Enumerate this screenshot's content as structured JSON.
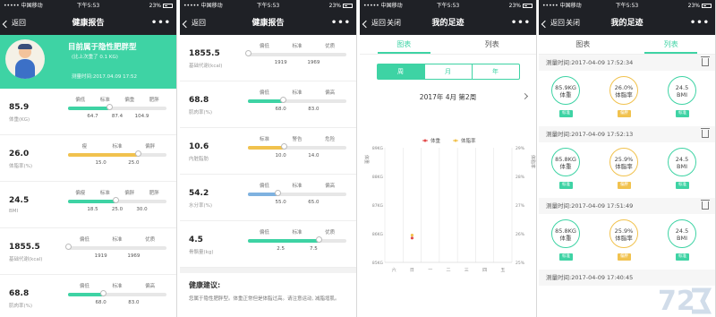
{
  "status": {
    "carrier": "••••• 中国移动",
    "time": "下午5:53",
    "battery": "23%"
  },
  "screen1": {
    "nav": {
      "back": "返回",
      "title": "健康报告",
      "more": "•••"
    },
    "hero": {
      "headline": "目前属于隐性肥胖型",
      "sub": "(比上次重了 0.1 KG)",
      "time": "测量时间:2017.04.09 17:52"
    },
    "metrics": [
      {
        "value": "85.9",
        "name": "体重(KG)",
        "cats": [
          "偏低",
          "标准",
          "偏重",
          "肥胖"
        ],
        "ticks": [
          "64.7",
          "87.4",
          "104.9"
        ],
        "fill_color": "#3ed3a4",
        "position": 0.42
      },
      {
        "value": "26.0",
        "name": "体脂率(%)",
        "cats": [
          "瘦",
          "标准",
          "偏胖"
        ],
        "ticks": [
          "15.0",
          "25.0"
        ],
        "fill_color": "#f1c24e",
        "position": 0.71
      },
      {
        "value": "24.5",
        "name": "BMI",
        "cats": [
          "偏瘦",
          "标准",
          "偏胖",
          "肥胖"
        ],
        "ticks": [
          "18.5",
          "25.0",
          "30.0"
        ],
        "fill_color": "#3ed3a4",
        "position": 0.48
      },
      {
        "value": "1855.5",
        "name": "基础代谢(kcal)",
        "cats": [
          "偏低",
          "标准",
          "优质"
        ],
        "ticks": [
          "1919",
          "1969"
        ],
        "fill_color": "#3ed3a4",
        "position": 0.0
      },
      {
        "value": "68.8",
        "name": "肌肉率(%)",
        "cats": [
          "偏低",
          "标准",
          "偏高"
        ],
        "ticks": [
          "68.0",
          "83.0"
        ],
        "fill_color": "#3ed3a4",
        "position": 0.35
      }
    ]
  },
  "screen2": {
    "nav": {
      "back": "返回",
      "title": "健康报告",
      "more": "•••"
    },
    "metrics": [
      {
        "value": "1855.5",
        "name": "基础代谢(kcal)",
        "cats": [
          "偏低",
          "标准",
          "优质"
        ],
        "ticks": [
          "1919",
          "1969"
        ],
        "fill_color": "#3ed3a4",
        "position": 0.0
      },
      {
        "value": "68.8",
        "name": "肌肉率(%)",
        "cats": [
          "偏低",
          "标准",
          "偏高"
        ],
        "ticks": [
          "68.0",
          "83.0"
        ],
        "fill_color": "#3ed3a4",
        "position": 0.35
      },
      {
        "value": "10.6",
        "name": "内脏脂肪",
        "cats": [
          "标准",
          "警告",
          "危险"
        ],
        "ticks": [
          "10.0",
          "14.0"
        ],
        "fill_color": "#f1c24e",
        "position": 0.36
      },
      {
        "value": "54.2",
        "name": "水分率(%)",
        "cats": [
          "偏低",
          "标准",
          "偏高"
        ],
        "ticks": [
          "55.0",
          "65.0"
        ],
        "fill_color": "#7fb2e0",
        "position": 0.3
      },
      {
        "value": "4.5",
        "name": "骨骼量(kg)",
        "cats": [
          "偏低",
          "标准",
          "优质"
        ],
        "ticks": [
          "2.5",
          "7.5"
        ],
        "fill_color": "#3ed3a4",
        "position": 0.72
      }
    ],
    "advice_title": "健康建议:",
    "advice_text": "您属于隐性肥胖型。体重正常但是体脂过高。请注意运动, 减脂增肌。"
  },
  "screen3": {
    "nav": {
      "back": "返回",
      "close": "关闭",
      "title": "我的足迹",
      "more": "•••"
    },
    "tabs": [
      "图表",
      "列表"
    ],
    "seg": [
      "周",
      "月",
      "年"
    ],
    "week_label": "2017年 4月 第2周"
  },
  "screen4": {
    "nav": {
      "back": "返回",
      "close": "关闭",
      "title": "我的足迹",
      "more": "•••"
    },
    "tabs": [
      "图表",
      "列表"
    ],
    "records": [
      {
        "time": "测量时间:2017-04-09 17:52:34",
        "weight": "85.9KG",
        "weight_l": "体重",
        "weight_tag": "标准",
        "fat": "26.0%",
        "fat_l": "体脂率",
        "fat_tag": "偏胖",
        "bmi": "24.5",
        "bmi_l": "BMI",
        "bmi_tag": "标准"
      },
      {
        "time": "测量时间:2017-04-09 17:52:13",
        "weight": "85.8KG",
        "weight_l": "体重",
        "weight_tag": "标准",
        "fat": "25.9%",
        "fat_l": "体脂率",
        "fat_tag": "偏胖",
        "bmi": "24.5",
        "bmi_l": "BMI",
        "bmi_tag": "标准"
      },
      {
        "time": "测量时间:2017-04-09 17:51:49",
        "weight": "85.8KG",
        "weight_l": "体重",
        "weight_tag": "标准",
        "fat": "25.9%",
        "fat_l": "体脂率",
        "fat_tag": "偏胖",
        "bmi": "24.5",
        "bmi_l": "BMI",
        "bmi_tag": "标准"
      },
      {
        "time": "测量时间:2017-04-09 17:40:45"
      }
    ]
  },
  "chart_data": {
    "type": "scatter",
    "legend": [
      "体重",
      "体脂率"
    ],
    "series_colors": [
      "#e24b4b",
      "#f1c24e"
    ],
    "x_categories": [
      "六",
      "日",
      "一",
      "二",
      "三",
      "四",
      "五"
    ],
    "y_left_ticks": [
      "89KG",
      "88KG",
      "87KG",
      "86KG",
      "85KG"
    ],
    "y_left_label": "体重",
    "y_right_ticks": [
      "29%",
      "28%",
      "27%",
      "26%",
      "25%"
    ],
    "y_right_label": "体脂率",
    "y_left_range": [
      85,
      89
    ],
    "y_right_range": [
      25,
      29
    ],
    "points": [
      {
        "series": "体重",
        "x": "日",
        "y": 85.85
      },
      {
        "series": "体脂率",
        "x": "日",
        "y": 25.95
      }
    ]
  },
  "watermark": {
    "text": "72"
  }
}
